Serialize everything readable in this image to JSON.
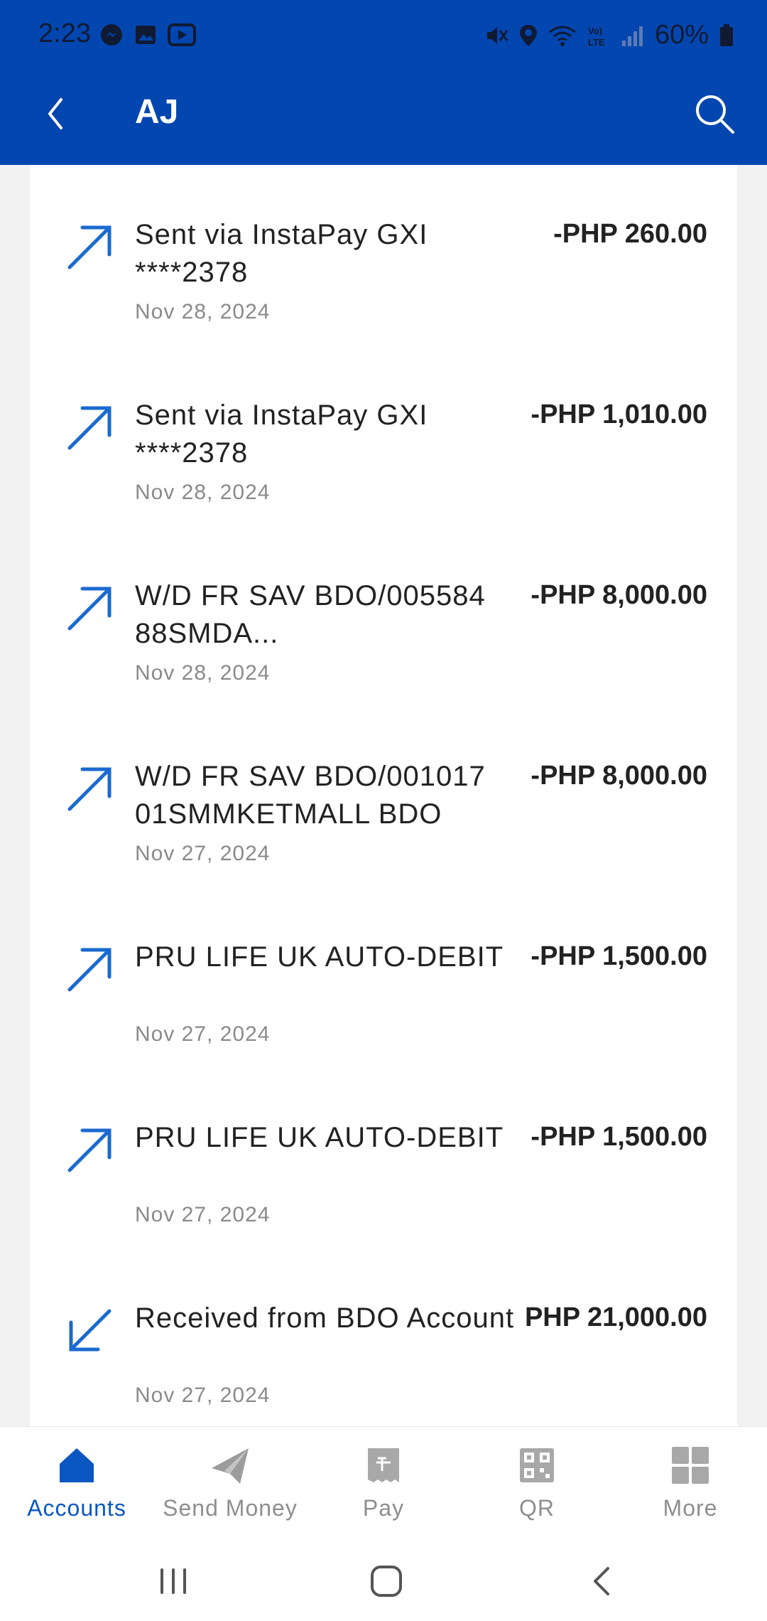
{
  "status_bar": {
    "time": "2:23",
    "battery": "60%",
    "left_icons": [
      "messenger-icon",
      "gallery-icon",
      "youtube-icon"
    ],
    "right_icons": [
      "mute-icon",
      "location-icon",
      "wifi-icon",
      "volte-icon",
      "signal-icon",
      "battery-icon"
    ],
    "volte_label": "Vo) LTE"
  },
  "header": {
    "title": "AJ",
    "background_color": "#0346b0"
  },
  "transactions": [
    {
      "description": "Sent via InstaPay GXI ****2378",
      "date": "Nov 28, 2024",
      "amount": "-PHP 260.00",
      "direction": "outgoing"
    },
    {
      "description": "Sent via InstaPay GXI ****2378",
      "date": "Nov 28, 2024",
      "amount": "-PHP 1,010.00",
      "direction": "outgoing"
    },
    {
      "description": "W/D FR SAV BDO/005584 88SMDA...",
      "date": "Nov 28, 2024",
      "amount": "-PHP 8,000.00",
      "direction": "outgoing"
    },
    {
      "description": "W/D FR SAV BDO/001017 01SMMKETMALL BDO",
      "date": "Nov 27, 2024",
      "amount": "-PHP 8,000.00",
      "direction": "outgoing"
    },
    {
      "description": "PRU LIFE UK AUTO-DEBIT",
      "date": "Nov 27, 2024",
      "amount": "-PHP 1,500.00",
      "direction": "outgoing"
    },
    {
      "description": "PRU LIFE UK AUTO-DEBIT",
      "date": "Nov 27, 2024",
      "amount": "-PHP 1,500.00",
      "direction": "outgoing"
    },
    {
      "description": "Received from BDO Account",
      "date": "Nov 27, 2024",
      "amount": "PHP 21,000.00",
      "direction": "incoming"
    }
  ],
  "bottom_nav": {
    "items": [
      {
        "label": "Accounts",
        "icon": "home-icon",
        "active": true
      },
      {
        "label": "Send Money",
        "icon": "paper-plane-icon",
        "active": false
      },
      {
        "label": "Pay",
        "icon": "bill-icon",
        "active": false
      },
      {
        "label": "QR",
        "icon": "qr-code-icon",
        "active": false
      },
      {
        "label": "More",
        "icon": "grid-icon",
        "active": false
      }
    ]
  },
  "colors": {
    "accent": "#0a57c2",
    "arrow": "#1a6ad0",
    "inactive": "#8e8e8e"
  }
}
